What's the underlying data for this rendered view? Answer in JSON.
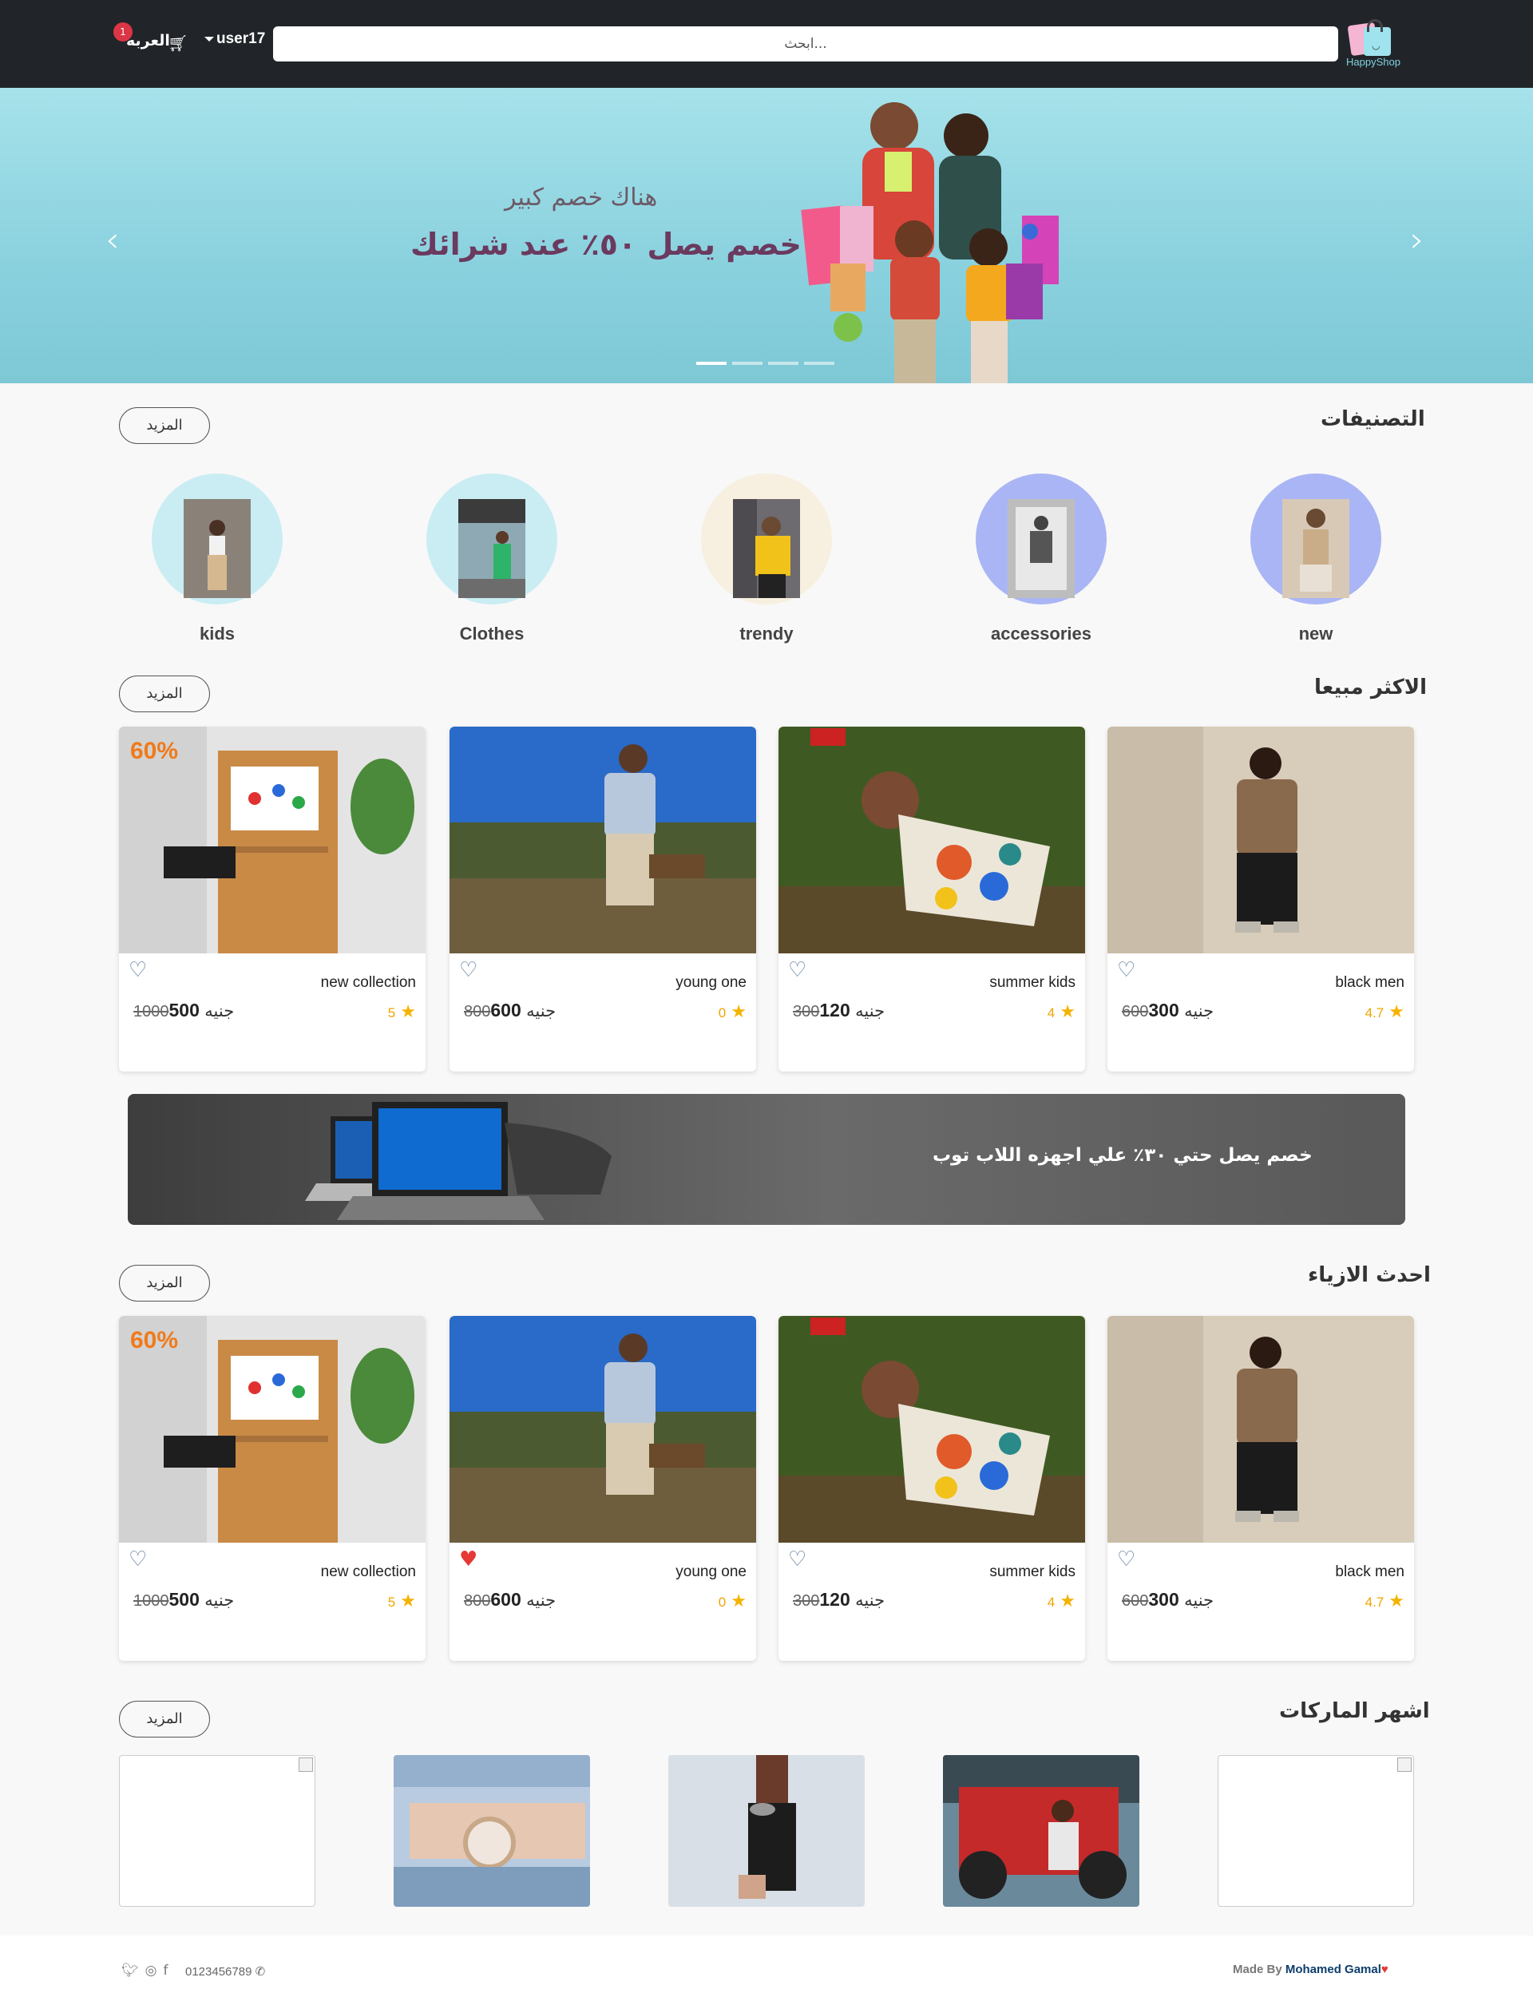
{
  "nav": {
    "logo_text_a": "Happy",
    "logo_text_b": "Shop",
    "search_placeholder": "ابحث...",
    "username": "user17",
    "cart_label": "العربه",
    "cart_count": "1"
  },
  "hero": {
    "subtitle": "هناك خصم كبير",
    "title": "خصم يصل ٥٠٪ عند شرائك",
    "prev_icon": "‹",
    "next_icon": "›",
    "slide_count": 4,
    "active_slide": 1
  },
  "categories": {
    "title": "التصنيفات",
    "more_label": "المزيد",
    "items": [
      {
        "label": "new",
        "color": "#aab5f5"
      },
      {
        "label": "accessories",
        "color": "#aab5f5"
      },
      {
        "label": "trendy",
        "color": "#f7efdf"
      },
      {
        "label": "Clothes",
        "color": "#c9edf3"
      },
      {
        "label": "kids",
        "color": "#c9edf3"
      }
    ]
  },
  "best_sellers": {
    "title": "الاكثر مبيعا",
    "more_label": "المزيد",
    "products": [
      {
        "name": "black men",
        "rating": "4.7",
        "new_price": "300",
        "old_price": "600",
        "currency": "جنيه",
        "liked": false
      },
      {
        "name": "summer kids",
        "rating": "4",
        "new_price": "120",
        "old_price": "300",
        "currency": "جنيه",
        "liked": false
      },
      {
        "name": "young one",
        "rating": "0",
        "new_price": "600",
        "old_price": "800",
        "currency": "جنيه",
        "liked": false
      },
      {
        "name": "new collection",
        "rating": "5",
        "new_price": "500",
        "old_price": "1000",
        "currency": "جنيه",
        "liked": false
      }
    ]
  },
  "laptop_banner": {
    "text": "خصم يصل حتي ٣٠٪ علي اجهزه اللاب توب"
  },
  "latest_fashion": {
    "title": "احدث الازياء",
    "more_label": "المزيد",
    "products": [
      {
        "name": "black men",
        "rating": "4.7",
        "new_price": "300",
        "old_price": "600",
        "currency": "جنيه",
        "liked": false
      },
      {
        "name": "summer kids",
        "rating": "4",
        "new_price": "120",
        "old_price": "300",
        "currency": "جنيه",
        "liked": false
      },
      {
        "name": "young one",
        "rating": "0",
        "new_price": "600",
        "old_price": "800",
        "currency": "جنيه",
        "liked": true
      },
      {
        "name": "new collection",
        "rating": "5",
        "new_price": "500",
        "old_price": "1000",
        "currency": "جنيه",
        "liked": false
      }
    ]
  },
  "brands": {
    "title": "اشهر الماركات",
    "more_label": "المزيد"
  },
  "footer": {
    "made_by": "Made By",
    "author": "Mohamed Gamal",
    "phone": "0123456789",
    "social_icons": [
      "twitter-icon",
      "instagram-icon",
      "facebook-icon"
    ]
  },
  "colors": {
    "navbar": "#212529",
    "badge": "#dc3545",
    "star": "#f5b301",
    "heart_filled": "#e53935"
  }
}
